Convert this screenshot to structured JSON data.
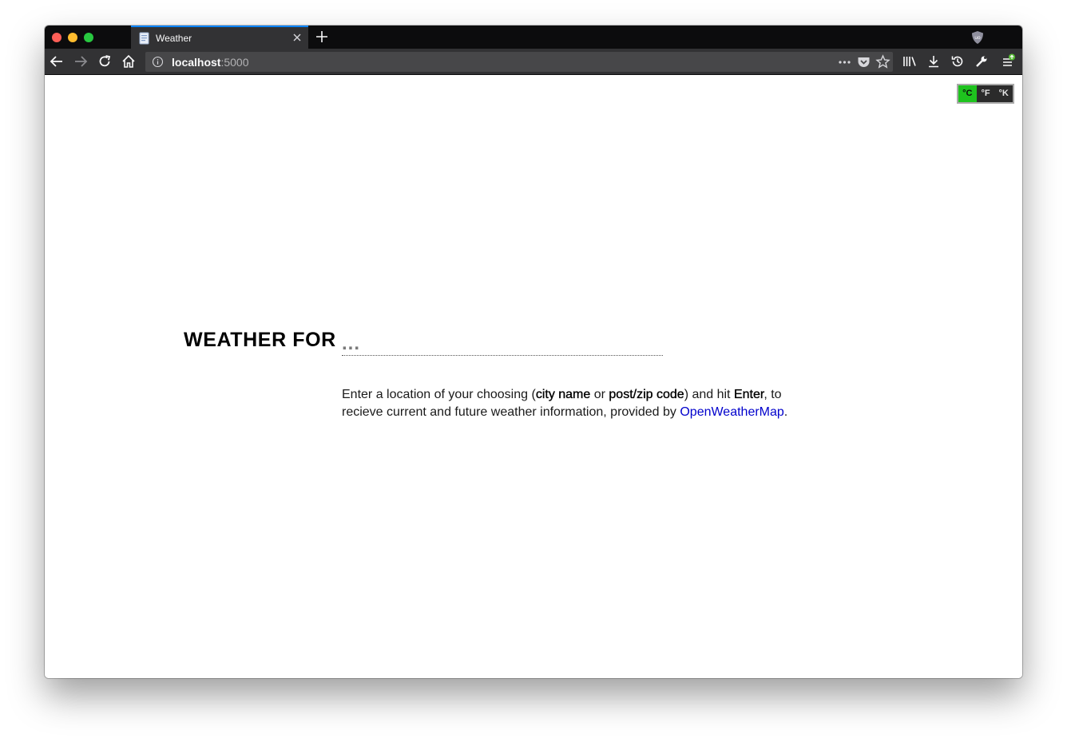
{
  "browser": {
    "tab": {
      "title": "Weather",
      "favicon": "page-icon"
    },
    "url": {
      "host": "localhost",
      "port": ":5000"
    },
    "icons": {
      "back": "back-arrow-icon",
      "forward": "forward-arrow-icon",
      "reload": "reload-icon",
      "home": "home-icon",
      "page_actions": "more-dots-icon",
      "pocket": "pocket-icon",
      "bookmark": "star-icon",
      "library": "library-icon",
      "downloads": "download-icon",
      "history": "history-icon",
      "tools": "wrench-icon",
      "menu": "hamburger-menu-icon",
      "extension": "ublock-shield-icon"
    }
  },
  "units": {
    "items": [
      {
        "label": "°C",
        "active": true
      },
      {
        "label": "°F",
        "active": false
      },
      {
        "label": "°K",
        "active": false
      }
    ],
    "active_color": "#1ec31e"
  },
  "main": {
    "heading": "WEATHER FOR",
    "input_placeholder": "...",
    "input_value": "",
    "description": {
      "part1": "Enter a location of your choosing (",
      "city": "city name",
      "or": " or ",
      "postcode": "post/zip code",
      "part2": ") and hit ",
      "enter": "Enter",
      "part3": ", to recieve current and future weather information, provided by ",
      "link": "OpenWeatherMap",
      "end": "."
    },
    "link_color": "#0000cc"
  }
}
